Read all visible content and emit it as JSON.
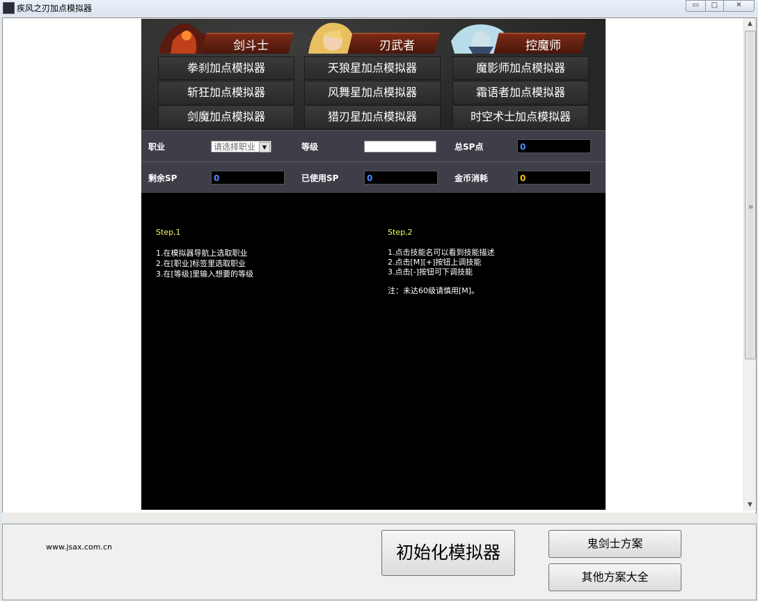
{
  "window": {
    "title": "疾风之刃加点模拟器",
    "min_glyph": "▭",
    "max_glyph": "□",
    "close_glyph": "✕"
  },
  "scrollbar": {
    "up_glyph": "▲",
    "down_glyph": "▼",
    "grip_glyph": "≡"
  },
  "classes": [
    {
      "name": "剑斗士",
      "portrait_icon": "warrior-portrait-icon",
      "items": [
        "拳刹加点模拟器",
        "斩狂加点模拟器",
        "剑魔加点模拟器"
      ]
    },
    {
      "name": "刃武者",
      "portrait_icon": "blade-portrait-icon",
      "items": [
        "天狼星加点模拟器",
        "风舞星加点模拟器",
        "猎刃星加点模拟器"
      ]
    },
    {
      "name": "控魔师",
      "portrait_icon": "mage-portrait-icon",
      "items": [
        "魔影师加点模拟器",
        "霜语者加点模拟器",
        "时空术士加点模拟器"
      ]
    }
  ],
  "form": {
    "job_label": "职业",
    "job_select": "请选择职业",
    "select_arrow": "▼",
    "level_label": "等级",
    "level_value": "",
    "total_sp_label": "总SP点",
    "total_sp_value": "0",
    "remaining_sp_label": "剩余SP",
    "remaining_sp_value": "0",
    "used_sp_label": "已使用SP",
    "used_sp_value": "0",
    "gold_label": "金币消耗",
    "gold_value": "0"
  },
  "steps": {
    "step1_title": "Step,1",
    "step1_lines": [
      "1.在模拟器导航上选取职业",
      "2.在[职业]标签里选取职业",
      "3.在[等级]里输入想要的等级"
    ],
    "step2_title": "Step,2",
    "step2_lines": [
      "1.点击技能名可以看到技能描述",
      "2.点击[M][+]按钮上调技能",
      "3.点击[-]按钮可下调技能"
    ],
    "step2_note": "注：未达60级请慎用[M]。"
  },
  "footer": {
    "url": "www.jsax.com.cn",
    "init_button": "初始化模拟器",
    "ghost_button": "鬼剑士方案",
    "other_button": "其他方案大全"
  },
  "colors": {
    "sp_value": "#4d8bff",
    "gold_value": "#ffc000",
    "step_title": "#ffff66",
    "banner": "#7b2a16"
  }
}
